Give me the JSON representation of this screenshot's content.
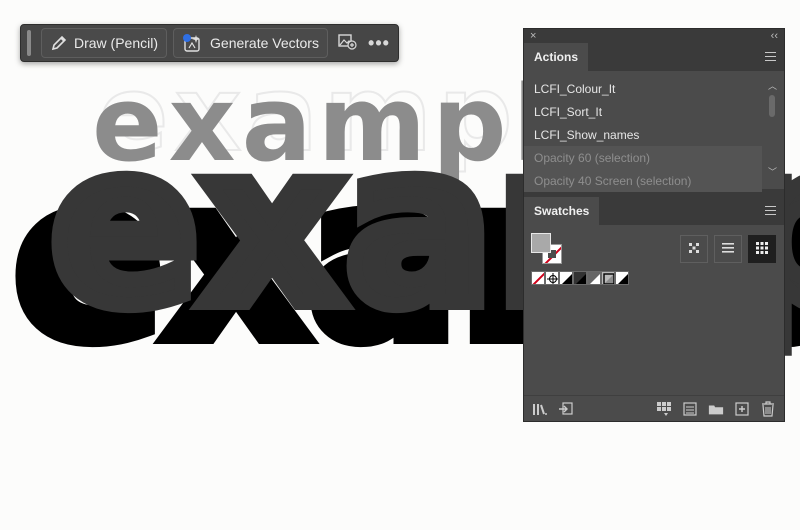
{
  "artwork": {
    "word_back": "example",
    "word_front": "example"
  },
  "taskbar": {
    "draw_label": "Draw (Pencil)",
    "generate_label": "Generate Vectors",
    "more_label": "•••"
  },
  "panel": {
    "close_glyph": "×",
    "collapse_glyph": "‹‹",
    "actions": {
      "tab_label": "Actions",
      "items": [
        {
          "label": "LCFI_Colour_It"
        },
        {
          "label": "LCFI_Sort_It"
        },
        {
          "label": "LCFI_Show_names"
        },
        {
          "label": "Opacity 60 (selection)"
        },
        {
          "label": "Opacity 40 Screen (selection)"
        }
      ]
    },
    "swatches": {
      "tab_label": "Swatches",
      "fill_color": "#a9a9a9",
      "swatch_colors": [
        "none",
        "registration",
        "#000000",
        "#333333",
        "#666666",
        "pattern",
        "gradient"
      ]
    }
  },
  "icons": {
    "pencil": "pencil-icon",
    "generate": "sparkle-vector-icon",
    "image_add": "image-add-icon",
    "more": "more-icon",
    "menu": "hamburger-menu-icon",
    "libraries": "libraries-icon",
    "import": "import-icon",
    "swatch_kind": "swatch-kind-icon",
    "swatch_options": "swatch-options-icon",
    "new_group": "folder-icon",
    "new_swatch": "new-swatch-icon",
    "delete": "trash-icon"
  },
  "colors": {
    "accent_blue": "#2f6fe4",
    "none_red": "#d0021b",
    "panel_bg": "#4b4b4b",
    "taskbar_bg": "#464646"
  }
}
